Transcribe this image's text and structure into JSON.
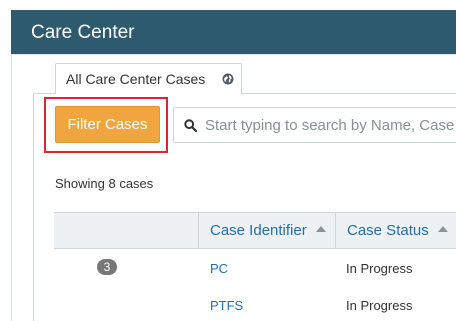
{
  "header": {
    "title": "Care Center"
  },
  "tabs": [
    {
      "label": "All Care Center Cases",
      "icon": "globe-icon"
    }
  ],
  "toolbar": {
    "filter_button_label": "Filter Cases",
    "search_placeholder": "Start typing to search by Name, Case"
  },
  "summary": {
    "showing_text": "Showing 8 cases"
  },
  "table": {
    "columns": [
      {
        "label": ""
      },
      {
        "label": "Case Identifier",
        "sort": "ascending"
      },
      {
        "label": "Case Status",
        "sort": "ascending"
      }
    ],
    "rows": [
      {
        "badge": "3",
        "case_identifier": "PC",
        "case_status": "In Progress"
      },
      {
        "badge": "",
        "case_identifier": "PTFS",
        "case_status": "In Progress"
      }
    ]
  },
  "colors": {
    "header_background": "#2d5a6e",
    "primary_action": "#f0a541",
    "highlight_border": "#d7282f",
    "link": "#1f6fae"
  }
}
